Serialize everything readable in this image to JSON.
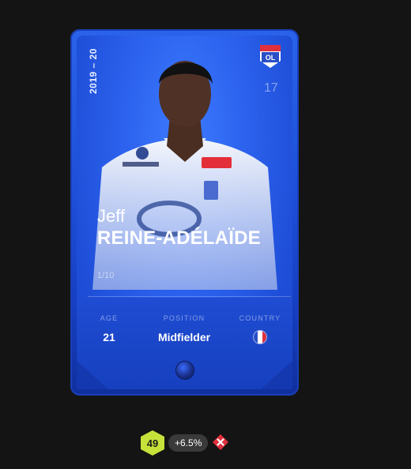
{
  "card": {
    "season": "2019 – 20",
    "first_name": "Jeff",
    "last_name": "REINE-ADÉLAÏDE",
    "number": "17",
    "serial": "1/10",
    "club_logo_icon": "olympique-lyonnais-crest-icon",
    "stats": {
      "age_label": "AGE",
      "age_value": "21",
      "position_label": "POSITION",
      "position_value": "Midfielder",
      "country_label": "COUNTRY",
      "country_flag_icon": "france-flag-icon"
    },
    "colors": {
      "card_blue": "#1f4fd9",
      "flag_blue": "#2a4fc7",
      "flag_white": "#ffffff",
      "flag_red": "#e0303e"
    }
  },
  "badges": {
    "score": "49",
    "score_color": "#c6e23a",
    "delta": "+6.5%",
    "status_icon": "red-x-icon",
    "status_color": "#e0303e"
  }
}
